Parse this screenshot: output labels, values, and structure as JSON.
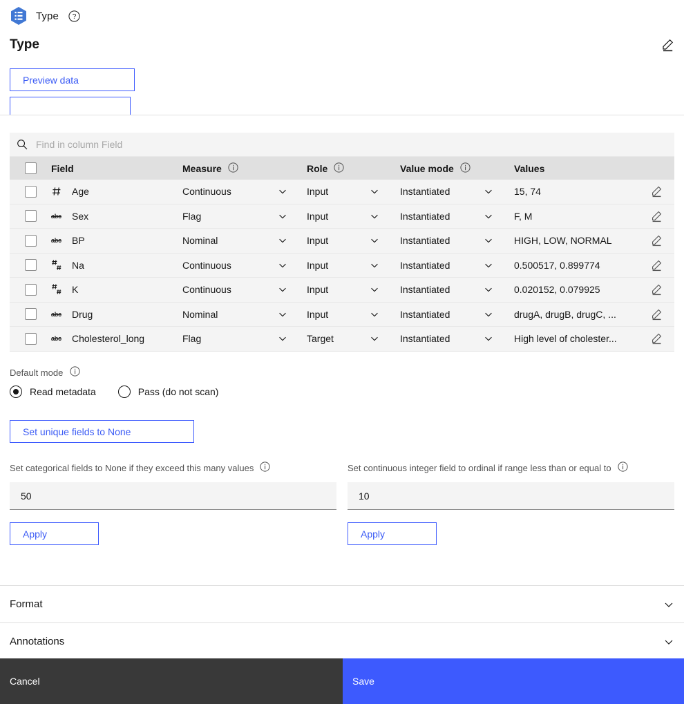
{
  "topbar": {
    "node_icon": "hexagon-type-node-icon",
    "title": "Type",
    "help_icon": "help-circle-icon"
  },
  "header": {
    "page_title": "Type",
    "edit_icon": "edit-pencil-icon"
  },
  "buttons": {
    "preview_data": "Preview data",
    "set_unique_fields_to_none": "Set unique fields to None"
  },
  "search": {
    "icon": "search-icon",
    "placeholder": "Find in column Field",
    "value": ""
  },
  "table": {
    "columns": [
      {
        "key": "field",
        "label": "Field",
        "info": false
      },
      {
        "key": "measure",
        "label": "Measure",
        "info": true
      },
      {
        "key": "role",
        "label": "Role",
        "info": true
      },
      {
        "key": "value_mode",
        "label": "Value mode",
        "info": true
      },
      {
        "key": "values",
        "label": "Values",
        "info": false
      }
    ],
    "rows": [
      {
        "selected": false,
        "type_icon": "integer-icon",
        "field": "Age",
        "measure": "Continuous",
        "role": "Input",
        "value_mode": "Instantiated",
        "values": "15, 74"
      },
      {
        "selected": false,
        "type_icon": "string-icon",
        "field": "Sex",
        "measure": "Flag",
        "role": "Input",
        "value_mode": "Instantiated",
        "values": "F, M"
      },
      {
        "selected": false,
        "type_icon": "string-icon",
        "field": "BP",
        "measure": "Nominal",
        "role": "Input",
        "value_mode": "Instantiated",
        "values": "HIGH, LOW, NORMAL"
      },
      {
        "selected": false,
        "type_icon": "real-icon",
        "field": "Na",
        "measure": "Continuous",
        "role": "Input",
        "value_mode": "Instantiated",
        "values": "0.500517, 0.899774"
      },
      {
        "selected": false,
        "type_icon": "real-icon",
        "field": "K",
        "measure": "Continuous",
        "role": "Input",
        "value_mode": "Instantiated",
        "values": "0.020152, 0.079925"
      },
      {
        "selected": false,
        "type_icon": "string-icon",
        "field": "Drug",
        "measure": "Nominal",
        "role": "Input",
        "value_mode": "Instantiated",
        "values": "drugA, drugB, drugC, ..."
      },
      {
        "selected": false,
        "type_icon": "string-icon",
        "field": "Cholesterol_long",
        "measure": "Flag",
        "role": "Target",
        "value_mode": "Instantiated",
        "values": "High level of cholester..."
      }
    ]
  },
  "default_mode": {
    "label": "Default mode",
    "info_icon": "info-icon",
    "options": [
      {
        "label": "Read metadata",
        "selected": true
      },
      {
        "label": "Pass (do not scan)",
        "selected": false
      }
    ]
  },
  "categorical_setting": {
    "label": "Set categorical fields to None if they exceed this many values",
    "info_icon": "info-icon",
    "value": "50",
    "apply_label": "Apply"
  },
  "continuous_setting": {
    "label": "Set continuous integer field to ordinal if range less than or equal to",
    "info_icon": "info-icon",
    "value": "10",
    "apply_label": "Apply"
  },
  "accordions": [
    {
      "label": "Format",
      "expanded": false,
      "chevron": "chevron-down-icon"
    },
    {
      "label": "Annotations",
      "expanded": false,
      "chevron": "chevron-down-icon"
    }
  ],
  "footer": {
    "cancel_label": "Cancel",
    "save_label": "Save"
  },
  "colors": {
    "accent_blue": "#3d5afe",
    "link_blue": "#3b5bf5",
    "cancel_dark": "#393939",
    "row_bg": "#f4f4f4",
    "header_bg": "#e0e0e0"
  }
}
